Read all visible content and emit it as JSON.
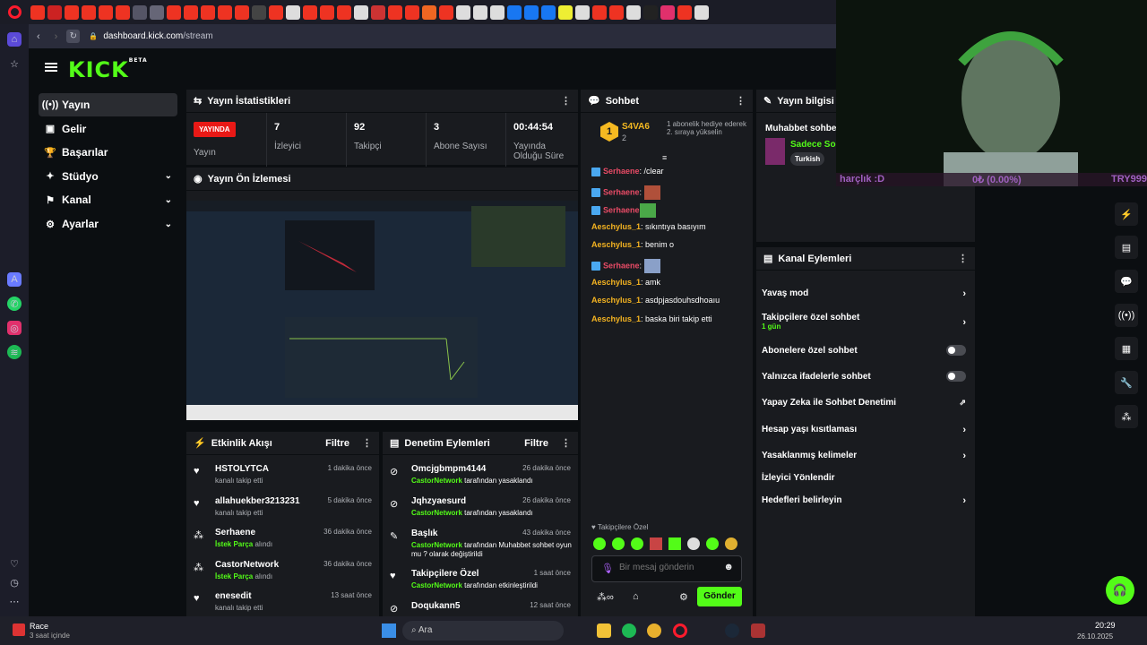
{
  "browser": {
    "url_host": "dashboard.kick.com",
    "url_path": "/stream"
  },
  "brand": {
    "logo": "KICK",
    "logo_sup": "BETA"
  },
  "nav": [
    {
      "label": "Yayın",
      "icon": "broadcast-icon",
      "active": true,
      "chevron": false
    },
    {
      "label": "Gelir",
      "icon": "wallet-icon",
      "chevron": false
    },
    {
      "label": "Başarılar",
      "icon": "trophy-icon",
      "chevron": false
    },
    {
      "label": "Stüdyo",
      "icon": "studio-icon",
      "chevron": true
    },
    {
      "label": "Kanal",
      "icon": "channel-icon",
      "chevron": true
    },
    {
      "label": "Ayarlar",
      "icon": "gear-icon",
      "chevron": true
    }
  ],
  "stats": {
    "title": "Yayın İstatistikleri",
    "live_badge": "YAYINDA",
    "live_label": "Yayın",
    "items": [
      {
        "value": "7",
        "label": "İzleyici"
      },
      {
        "value": "92",
        "label": "Takipçi"
      },
      {
        "value": "3",
        "label": "Abone Sayısı"
      },
      {
        "value": "00:44:54",
        "label": "Yayında Olduğu Süre"
      }
    ]
  },
  "preview": {
    "title": "Yayın Ön İzlemesi"
  },
  "activity": {
    "title": "Etkinlik Akışı",
    "filter": "Filtre",
    "items": [
      {
        "icon": "heart-icon",
        "name": "HSTOLYTCA",
        "line": "kanalı takip etti",
        "time": "1 dakika önce"
      },
      {
        "icon": "heart-icon",
        "name": "allahuekber3213231",
        "line": "kanalı takip etti",
        "time": "5 dakika önce"
      },
      {
        "icon": "points-icon",
        "name": "Serhaene",
        "hl": "İstek Parça",
        "rest": " alındı",
        "time": "36 dakika önce"
      },
      {
        "icon": "points-icon",
        "name": "CastorNetwork",
        "hl": "İstek Parça",
        "rest": " alındı",
        "time": "36 dakika önce"
      },
      {
        "icon": "heart-icon",
        "name": "enesedit",
        "line": "kanalı takip etti",
        "time": "13 saat önce"
      }
    ]
  },
  "moderation": {
    "title": "Denetim Eylemleri",
    "filter": "Filtre",
    "items": [
      {
        "icon": "ban-icon",
        "name": "Omcjgbmpm4144",
        "hl": "CastorNetwork",
        "rest": " tarafından yasaklandı",
        "time": "26 dakika önce"
      },
      {
        "icon": "ban-icon",
        "name": "Jqhzyaesurd",
        "hl": "CastorNetwork",
        "rest": " tarafından yasaklandı",
        "time": "26 dakika önce"
      },
      {
        "icon": "title-icon",
        "name": "Başlık",
        "hl": "CastorNetwork",
        "rest": " tarafından Muhabbet sohbet oyun mu ? olarak değiştirildi",
        "time": "43 dakika önce"
      },
      {
        "icon": "heart-icon",
        "name": "Takipçilere Özel",
        "hl": "CastorNetwork",
        "rest": " tarafından etkinleştirildi",
        "time": "1 saat önce"
      },
      {
        "icon": "ban-icon",
        "name": "Doqukann5",
        "hl": "",
        "rest": "",
        "time": "12 saat önce"
      }
    ]
  },
  "chat": {
    "title": "Sohbet",
    "top_rank": "1",
    "top_user": "S4VA6",
    "top_count": "2",
    "gift_text": "1 abonelik hediye ederek 2. sıraya yükselin",
    "messages": [
      {
        "user": "Serhaene",
        "cls": "u-r",
        "badge": true,
        "text": ": /clear"
      },
      {
        "user": "Serhaene",
        "cls": "u-r",
        "badge": true,
        "text": ": ",
        "emote": "#b0503a"
      },
      {
        "user": "Serhaene",
        "cls": "u-r",
        "badge": true,
        "text": "",
        "emote": "#4aa848"
      },
      {
        "user": "Aeschylus_1",
        "cls": "u-o",
        "badge": false,
        "text": ": sıkıntıya basıyım"
      },
      {
        "user": "Aeschylus_1",
        "cls": "u-o",
        "badge": false,
        "text": ": benim o"
      },
      {
        "user": "Serhaene",
        "cls": "u-r",
        "badge": true,
        "text": ": ",
        "emote": "#8aa0c8"
      },
      {
        "user": "Aeschylus_1",
        "cls": "u-o",
        "badge": false,
        "text": ": amk"
      },
      {
        "user": "Aeschylus_1",
        "cls": "u-o",
        "badge": false,
        "text": ": asdpjasdouhsdhoaıu"
      },
      {
        "user": "Aeschylus_1",
        "cls": "u-o",
        "badge": false,
        "text": ": baska biri takip etti"
      }
    ],
    "followers_only": "Takipçilere Özel",
    "placeholder": "Bir mesaj gönderin",
    "send": "Gönder"
  },
  "stream_info": {
    "title": "Yayın bilgisi",
    "stream_title": "Muhabbet sohbet",
    "category": "Sadece Soh",
    "tag": "Turkish"
  },
  "channel_actions": {
    "title": "Kanal Eylemleri",
    "items": [
      {
        "label": "Yavaş mod",
        "type": "arrow"
      },
      {
        "label": "Takipçilere özel sohbet",
        "sub": "1 gün",
        "type": "arrow"
      },
      {
        "label": "Abonelere özel sohbet",
        "type": "toggle"
      },
      {
        "label": "Yalnızca ifadelerle sohbet",
        "type": "toggle"
      },
      {
        "label": "Yapay Zeka ile Sohbet Denetimi",
        "type": "external"
      },
      {
        "label": "Hesap yaşı kısıtlaması",
        "type": "arrow"
      },
      {
        "label": "Yasaklanmış kelimeler",
        "type": "arrow"
      },
      {
        "label": "İzleyici Yönlendir",
        "type": "none"
      },
      {
        "label": "Hedefleri belirleyin",
        "type": "arrow"
      }
    ]
  },
  "overlay": {
    "left": "harçlık :D",
    "mid": "0₺ (0.00%)",
    "right": "TRY999"
  },
  "taskbar": {
    "app_name": "Race",
    "app_sub": "3 saat içinde",
    "search": "Ara",
    "time": "20:29",
    "date": "26.10.2025"
  },
  "colors": {
    "kick_green": "#53fc18",
    "live_red": "#e91916",
    "panel": "#191b1f",
    "bg": "#0b0e11"
  }
}
